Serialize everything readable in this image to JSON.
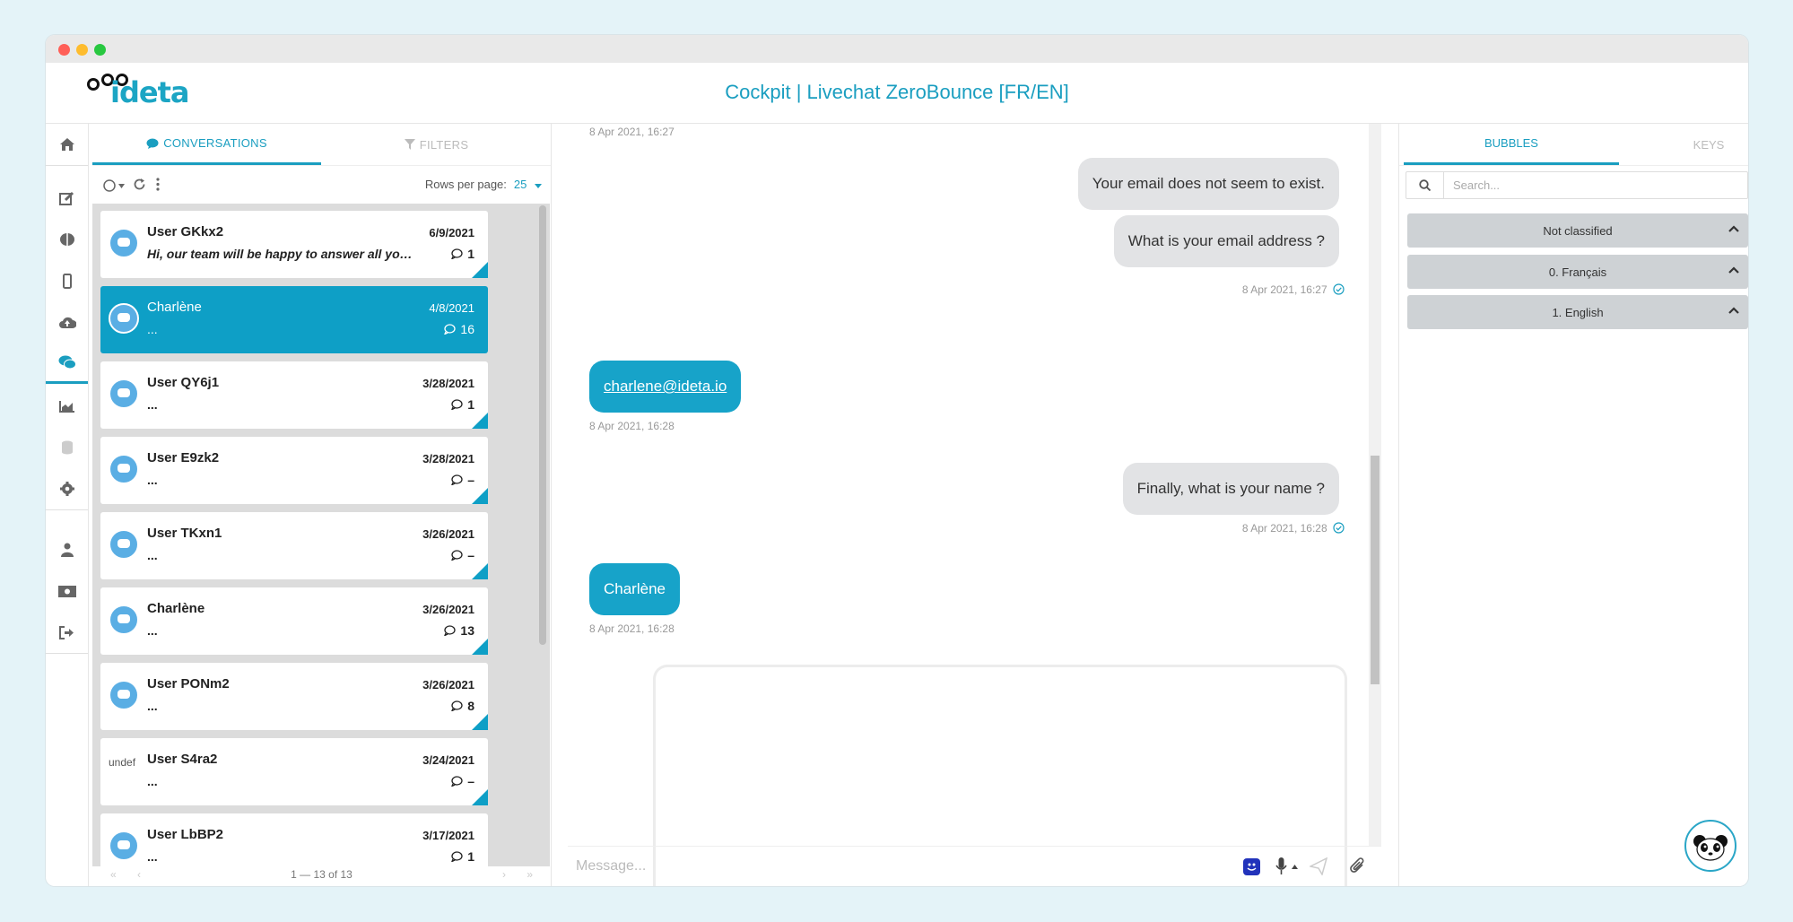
{
  "window": {
    "title": "Cockpit | Livechat ZeroBounce [FR/EN]"
  },
  "logo": {
    "text": "ideta"
  },
  "sidebar": {
    "icons": [
      "home-icon",
      "edit-icon",
      "brain-icon",
      "mobile-icon",
      "cloud-upload-icon",
      "chat-icon",
      "chart-icon",
      "database-icon",
      "gear-icon",
      "user-icon",
      "money-icon",
      "logout-icon"
    ]
  },
  "conversations": {
    "tabs": [
      {
        "label": "CONVERSATIONS"
      },
      {
        "label": "FILTERS"
      }
    ],
    "rows_label": "Rows per page:",
    "rows_value": "25",
    "pager": "1 — 13 of 13",
    "items": [
      {
        "name": "User GKkx2",
        "date": "6/9/2021",
        "preview": "Hi, our team will be happy to answer all your q...",
        "count": "1"
      },
      {
        "name": "Charlène",
        "date": "4/8/2021",
        "preview": "...",
        "count": "16"
      },
      {
        "name": "User QY6j1",
        "date": "3/28/2021",
        "preview": "...",
        "count": "1"
      },
      {
        "name": "User E9zk2",
        "date": "3/28/2021",
        "preview": "...",
        "count": "–"
      },
      {
        "name": "User TKxn1",
        "date": "3/26/2021",
        "preview": "...",
        "count": "–"
      },
      {
        "name": "Charlène",
        "date": "3/26/2021",
        "preview": "...",
        "count": "13"
      },
      {
        "name": "User PONm2",
        "date": "3/26/2021",
        "preview": "...",
        "count": "8"
      },
      {
        "name": "User S4ra2",
        "date": "3/24/2021",
        "preview": "...",
        "count": "–",
        "avatar_alt": "undef"
      },
      {
        "name": "User LbBP2",
        "date": "3/17/2021",
        "preview": "...",
        "count": "1"
      }
    ]
  },
  "chat": {
    "messages": [
      {
        "ts": "8 Apr 2021, 16:27"
      },
      {
        "text": "Your email does not seem to exist."
      },
      {
        "text": "What is your email address ?"
      },
      {
        "ts": "8 Apr 2021, 16:27"
      },
      {
        "text": "charlene@ideta.io"
      },
      {
        "ts": "8 Apr 2021, 16:28"
      },
      {
        "text": "Finally, what is your name ?"
      },
      {
        "ts": "8 Apr 2021, 16:28"
      },
      {
        "text": "Charlène"
      },
      {
        "ts": "8 Apr 2021, 16:28"
      }
    ],
    "composer_placeholder": "Message..."
  },
  "right_panel": {
    "tabs": [
      {
        "label": "BUBBLES"
      },
      {
        "label": "KEYS"
      }
    ],
    "search_placeholder": "Search...",
    "sections": [
      {
        "label": "Not classified"
      },
      {
        "label": "0. Français"
      },
      {
        "label": "1. English"
      }
    ]
  },
  "colors": {
    "accent": "#1a9ec0",
    "selected": "#0e9fc6",
    "bubble_user": "#17a3c9",
    "bubble_bot": "#e2e3e5"
  }
}
